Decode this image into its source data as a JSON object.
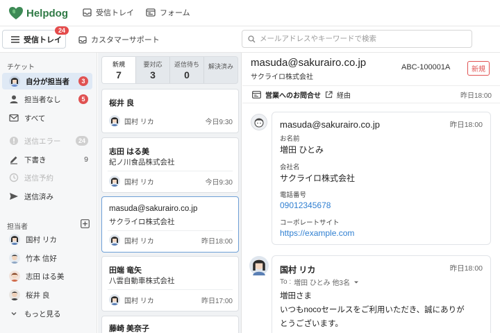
{
  "app": {
    "name": "Helpdog"
  },
  "topnav": {
    "inbox_label": "受信トレイ",
    "form_label": "フォーム"
  },
  "toolbar": {
    "inbox_button_label": "受信トレイ",
    "inbox_badge": "24",
    "support_label": "カスタマーサポート",
    "search_placeholder": "メールアドレスやキーワードで検索"
  },
  "sidebar": {
    "tickets_heading": "チケット",
    "items": [
      {
        "label": "自分が担当者",
        "count": "3"
      },
      {
        "label": "担当者なし",
        "count": "5"
      },
      {
        "label": "すべて"
      },
      {
        "label": "送信エラー",
        "count": "24"
      },
      {
        "label": "下書き",
        "count": "9"
      },
      {
        "label": "送信予約"
      },
      {
        "label": "送信済み"
      }
    ],
    "assignees_heading": "担当者",
    "assignees": [
      {
        "name": "国村 リカ"
      },
      {
        "name": "竹本 信好"
      },
      {
        "name": "志田 はる美"
      },
      {
        "name": "桜井 良"
      }
    ],
    "more_label": "もっと見る"
  },
  "status_tabs": [
    {
      "label": "新規",
      "count": "7"
    },
    {
      "label": "要対応",
      "count": "3"
    },
    {
      "label": "返信待ち",
      "count": "0"
    },
    {
      "label": "解決済み",
      "count": ""
    }
  ],
  "tickets": [
    {
      "name": "桜井 良",
      "company": "",
      "assignee": "国村 リカ",
      "time": "今日9:30"
    },
    {
      "name": "志田 はる美",
      "company": "紀ノ川食品株式会社",
      "assignee": "国村 リカ",
      "time": "今日9:30"
    },
    {
      "name": "masuda@sakurairo.co.jp",
      "company": "サクライロ株式会社",
      "assignee": "国村 リカ",
      "time": "昨日18:00"
    },
    {
      "name": "田端 竜矢",
      "company": "八雲自動車株式会社",
      "assignee": "国村 リカ",
      "time": "昨日17:00"
    },
    {
      "name": "藤崎 美奈子"
    }
  ],
  "detail": {
    "email": "masuda@sakurairo.co.jp",
    "company": "サクライロ株式会社",
    "ticket_id": "ABC-100001A",
    "status_badge": "新規",
    "source_label": "営業へのお問合せ",
    "via_label": "経由",
    "source_time": "昨日18:00",
    "form_message": {
      "title": "masuda@sakurairo.co.jp",
      "time": "昨日18:00",
      "fields": [
        {
          "label": "お名前",
          "value": "増田 ひとみ"
        },
        {
          "label": "会社名",
          "value": "サクライロ株式会社"
        },
        {
          "label": "電話番号",
          "value": "09012345678"
        },
        {
          "label": "コーポレートサイト",
          "value": "https://example.com"
        }
      ]
    },
    "reply": {
      "sender": "国村 リカ",
      "time": "昨日18:00",
      "to_label": "To :",
      "to_value": "増田 ひとみ 他3名",
      "lines": [
        "増田さま",
        "いつもnocoセールスをご利用いただき、誠にありが",
        "とうございます。"
      ]
    }
  }
}
